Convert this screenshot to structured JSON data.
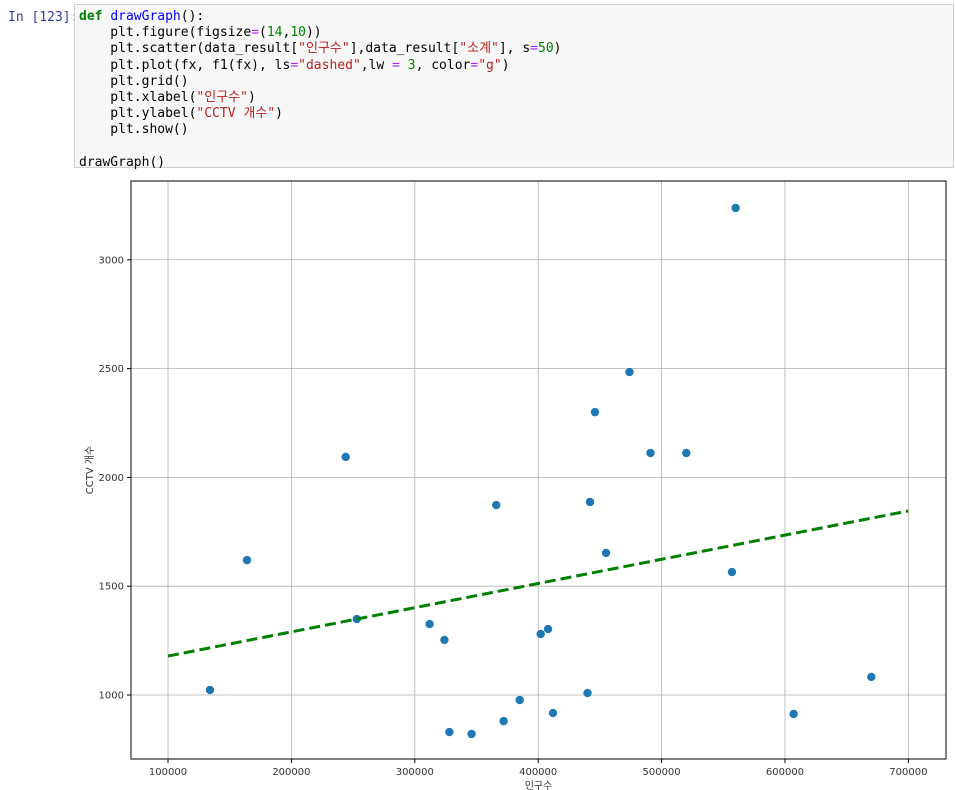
{
  "cell": {
    "prompt": "In [123]:",
    "code_lines": [
      [
        {
          "t": "def",
          "c": "kw"
        },
        {
          "t": " "
        },
        {
          "t": "drawGraph",
          "c": "fn"
        },
        {
          "t": "():"
        }
      ],
      [
        {
          "t": "    plt.figure(figsize"
        },
        {
          "t": "=",
          "c": "op"
        },
        {
          "t": "("
        },
        {
          "t": "14",
          "c": "num"
        },
        {
          "t": ","
        },
        {
          "t": "10",
          "c": "num"
        },
        {
          "t": "))"
        }
      ],
      [
        {
          "t": "    plt.scatter(data_result["
        },
        {
          "t": "\"인구수\"",
          "c": "str"
        },
        {
          "t": "],data_result["
        },
        {
          "t": "\"소계\"",
          "c": "str"
        },
        {
          "t": "], s"
        },
        {
          "t": "=",
          "c": "op"
        },
        {
          "t": "50",
          "c": "num"
        },
        {
          "t": ")"
        }
      ],
      [
        {
          "t": "    plt.plot(fx, f1(fx), ls"
        },
        {
          "t": "=",
          "c": "op"
        },
        {
          "t": "\"dashed\"",
          "c": "str"
        },
        {
          "t": ",lw "
        },
        {
          "t": "=",
          "c": "op"
        },
        {
          "t": " "
        },
        {
          "t": "3",
          "c": "num"
        },
        {
          "t": ", color"
        },
        {
          "t": "=",
          "c": "op"
        },
        {
          "t": "\"g\"",
          "c": "str"
        },
        {
          "t": ")"
        }
      ],
      [
        {
          "t": "    plt.grid()"
        }
      ],
      [
        {
          "t": "    plt.xlabel("
        },
        {
          "t": "\"인구수\"",
          "c": "str"
        },
        {
          "t": ")"
        }
      ],
      [
        {
          "t": "    plt.ylabel("
        },
        {
          "t": "\"CCTV 개수\"",
          "c": "str"
        },
        {
          "t": ")"
        }
      ],
      [
        {
          "t": "    plt.show()"
        }
      ],
      [
        {
          "t": ""
        }
      ],
      [
        {
          "t": "drawGraph()"
        }
      ]
    ]
  },
  "chart_data": {
    "type": "scatter",
    "title": "",
    "xlabel": "인구수",
    "ylabel": "CCTV 개수",
    "xlim": [
      70000,
      730500
    ],
    "ylim": [
      706,
      3362
    ],
    "xticks": [
      100000,
      200000,
      300000,
      400000,
      500000,
      600000,
      700000
    ],
    "yticks": [
      1000,
      1500,
      2000,
      2500,
      3000
    ],
    "grid": true,
    "point_color": "#1f77b4",
    "line_color": "#008000",
    "points": [
      [
        134000,
        1023
      ],
      [
        164000,
        1620
      ],
      [
        244000,
        2094
      ],
      [
        253000,
        1349
      ],
      [
        312000,
        1326
      ],
      [
        324000,
        1253
      ],
      [
        328000,
        830
      ],
      [
        346000,
        821
      ],
      [
        366000,
        1873
      ],
      [
        372000,
        880
      ],
      [
        385000,
        977
      ],
      [
        402000,
        1280
      ],
      [
        408000,
        1303
      ],
      [
        412000,
        917
      ],
      [
        440000,
        1009
      ],
      [
        442000,
        1887
      ],
      [
        446000,
        2300
      ],
      [
        455000,
        1653
      ],
      [
        474000,
        2484
      ],
      [
        491000,
        2112
      ],
      [
        520000,
        2112
      ],
      [
        557000,
        1565
      ],
      [
        560000,
        3238
      ],
      [
        607000,
        913
      ],
      [
        670000,
        1083
      ]
    ],
    "fit_line": {
      "x": [
        100000,
        700000
      ],
      "y": [
        1179,
        1846
      ],
      "style": "dashed"
    }
  }
}
